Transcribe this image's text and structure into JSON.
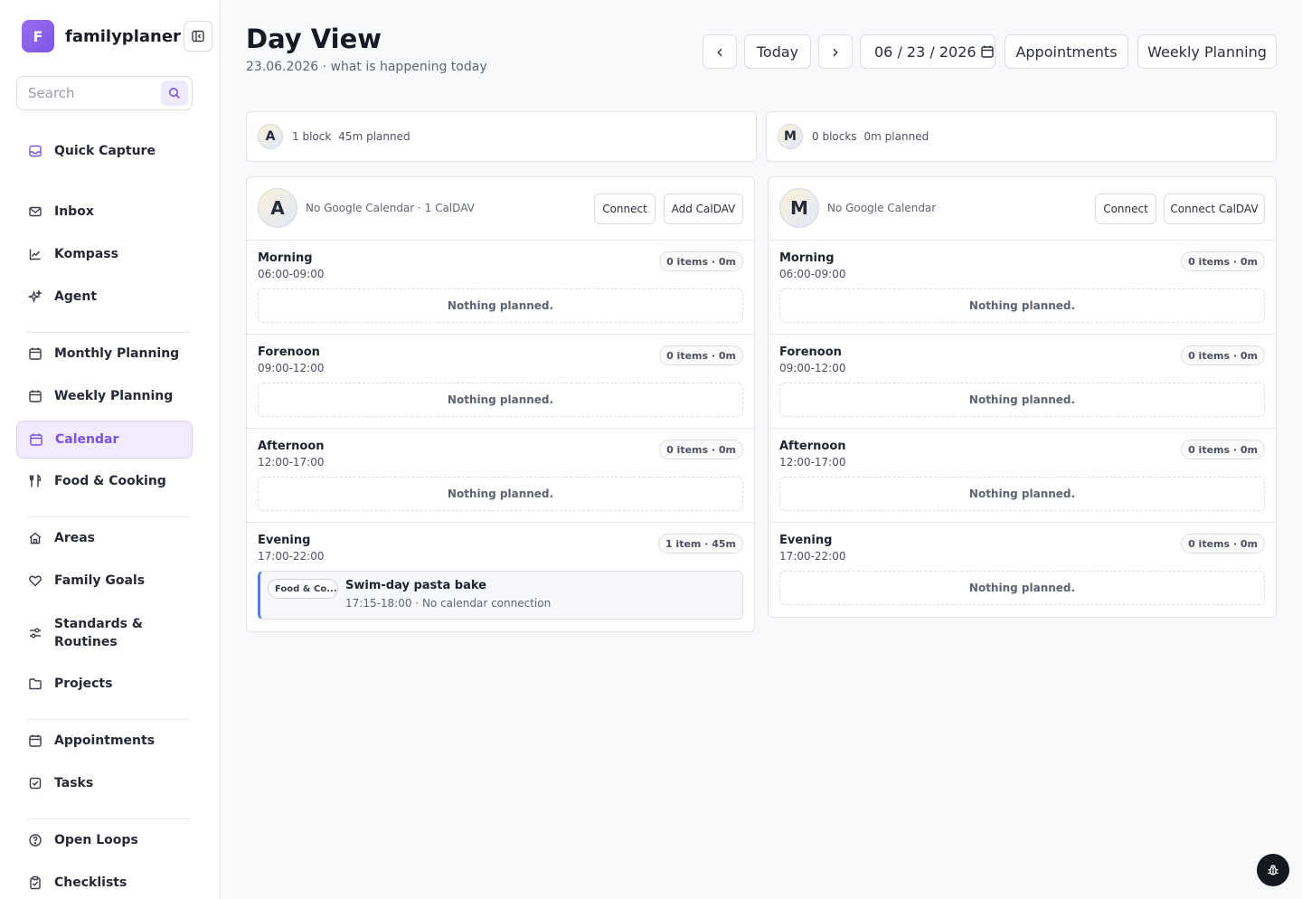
{
  "app": {
    "logo_letter": "F",
    "name": "familyplaner"
  },
  "search": {
    "placeholder": "Search"
  },
  "nav": {
    "quick_capture": "Quick Capture",
    "inbox": "Inbox",
    "kompass": "Kompass",
    "agent": "Agent",
    "monthly": "Monthly Planning",
    "weekly": "Weekly Planning",
    "calendar": "Calendar",
    "food": "Food & Cooking",
    "areas": "Areas",
    "goals": "Family Goals",
    "standards": "Standards & Routines",
    "projects": "Projects",
    "appointments": "Appointments",
    "tasks": "Tasks",
    "open_loops": "Open Loops",
    "checklists": "Checklists"
  },
  "header": {
    "title": "Day View",
    "subtitle": "23.06.2026 · what is happening today",
    "prev": "‹",
    "today": "Today",
    "next": "›",
    "date_value": "06 / 23 / 2026",
    "appointments": "Appointments",
    "weekly_planning": "Weekly Planning"
  },
  "summaries": [
    {
      "initial": "A",
      "blocks": "1 block",
      "planned": "45m planned"
    },
    {
      "initial": "M",
      "blocks": "0 blocks",
      "planned": "0m planned"
    }
  ],
  "columns": [
    {
      "initial": "A",
      "calendar_status": "No Google Calendar · 1 CalDAV",
      "btn_connect": "Connect",
      "btn_caldav": "Add CalDAV",
      "slots": [
        {
          "name": "Morning",
          "time": "06:00-09:00",
          "badge": "0 items · 0m",
          "empty": "Nothing planned."
        },
        {
          "name": "Forenoon",
          "time": "09:00-12:00",
          "badge": "0 items · 0m",
          "empty": "Nothing planned."
        },
        {
          "name": "Afternoon",
          "time": "12:00-17:00",
          "badge": "0 items · 0m",
          "empty": "Nothing planned."
        },
        {
          "name": "Evening",
          "time": "17:00-22:00",
          "badge": "1 item · 45m",
          "event": {
            "category": "Food & Co...",
            "title": "Swim-day pasta bake",
            "meta": "17:15-18:00 · No calendar connection"
          }
        }
      ]
    },
    {
      "initial": "M",
      "calendar_status": "No Google Calendar",
      "btn_connect": "Connect",
      "btn_caldav": "Connect CalDAV",
      "slots": [
        {
          "name": "Morning",
          "time": "06:00-09:00",
          "badge": "0 items · 0m",
          "empty": "Nothing planned."
        },
        {
          "name": "Forenoon",
          "time": "09:00-12:00",
          "badge": "0 items · 0m",
          "empty": "Nothing planned."
        },
        {
          "name": "Afternoon",
          "time": "12:00-17:00",
          "badge": "0 items · 0m",
          "empty": "Nothing planned."
        },
        {
          "name": "Evening",
          "time": "17:00-22:00",
          "badge": "0 items · 0m",
          "empty": "Nothing planned."
        }
      ]
    }
  ],
  "colors": {
    "accent": "#7b52e0",
    "event_bar": "#4f7fe8"
  }
}
